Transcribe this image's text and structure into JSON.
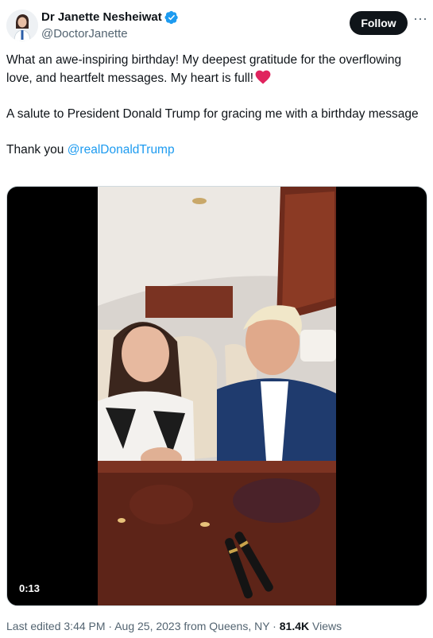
{
  "author": {
    "display_name": "Dr Janette Nesheiwat",
    "handle": "@DoctorJanette",
    "verified_icon": "verified-badge-icon"
  },
  "actions": {
    "follow_label": "Follow",
    "more_icon": "more-options-icon",
    "more_glyph": "···"
  },
  "tweet": {
    "line1": "What an awe-inspiring birthday! My deepest gratitude for the overflowing love, and heartfelt messages. My heart is full!",
    "line2": "A salute to President Donald Trump for gracing me with a birthday message",
    "line3_prefix": "Thank you ",
    "mention": "@realDonaldTrump"
  },
  "media": {
    "type": "video",
    "duration": "0:13"
  },
  "meta": {
    "edited_prefix": "Last edited ",
    "time": "3:44 PM",
    "separator": " · ",
    "date": "Aug 25, 2023",
    "location": " from Queens, NY",
    "views_count": "81.4K",
    "views_label": " Views"
  },
  "colors": {
    "link": "#1d9bf0",
    "verified": "#1d9bf0",
    "heart": "#e0245e",
    "follow_bg": "#0f1419"
  }
}
